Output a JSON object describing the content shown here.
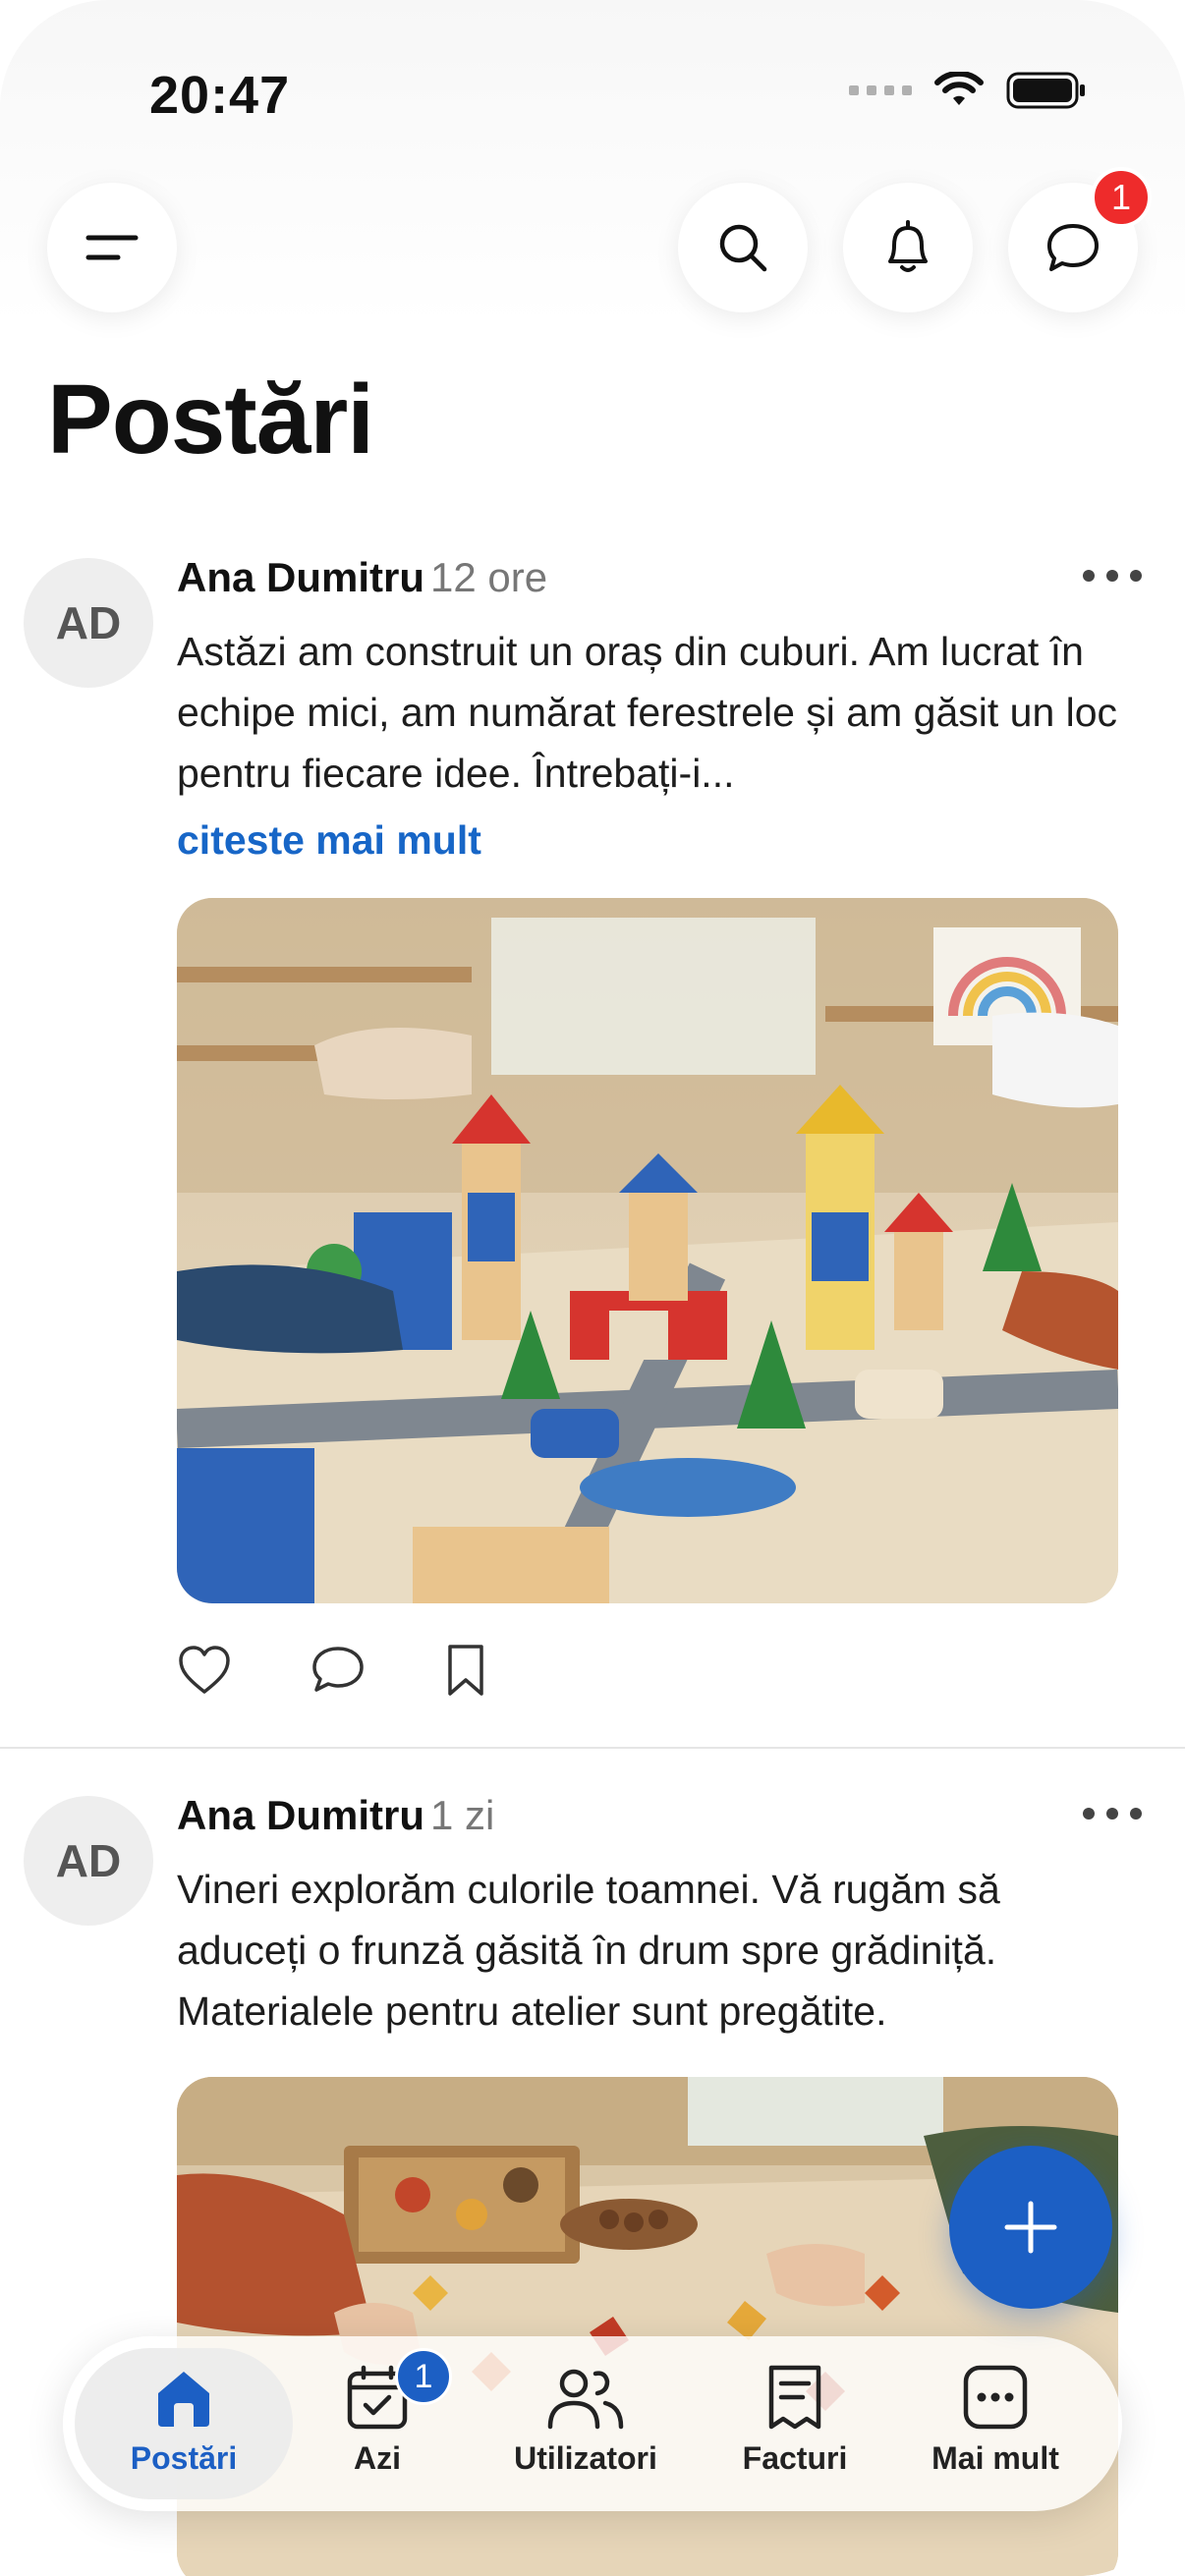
{
  "status_bar": {
    "time": "20:47"
  },
  "header": {
    "menu_icon": "menu-icon",
    "search_icon": "search-icon",
    "notifications_icon": "bell-icon",
    "messages_icon": "chat-icon",
    "messages_badge": "1"
  },
  "page": {
    "title": "Postări"
  },
  "posts": [
    {
      "avatar_initials": "AD",
      "author": "Ana Dumitru",
      "time": "12 ore",
      "text": "Astăzi am construit un oraș din cuburi. Am lucrat în echipe mici, am numărat ferestrele și am găsit un loc pentru fiecare idee. Întrebați-i...",
      "read_more": "citeste mai mult",
      "image_description_icon": "photo-blocks-city"
    },
    {
      "avatar_initials": "AD",
      "author": "Ana Dumitru",
      "time": "1 zi",
      "text": "Vineri explorăm culorile toamnei. Vă rugăm să aduceți o frunză găsită în drum spre grădiniță. Materialele pentru atelier sunt pregătite.",
      "image_description_icon": "photo-autumn-leaves"
    }
  ],
  "fab": {
    "icon": "plus-icon"
  },
  "tabbar": {
    "active": "Postări",
    "items": [
      {
        "label": "Postări",
        "icon": "home-icon"
      },
      {
        "label": "Azi",
        "icon": "calendar-check-icon",
        "badge": "1"
      },
      {
        "label": "Utilizatori",
        "icon": "users-icon"
      },
      {
        "label": "Facturi",
        "icon": "receipt-icon"
      },
      {
        "label": "Mai mult",
        "icon": "more-icon"
      }
    ]
  },
  "colors": {
    "accent": "#1c5fc4",
    "badge_red": "#ee2b2b",
    "link": "#1766c7"
  }
}
